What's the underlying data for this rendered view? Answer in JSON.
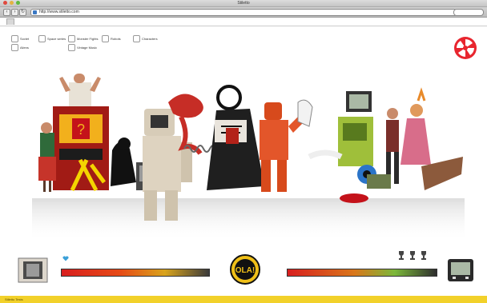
{
  "window": {
    "title": "Stiletto"
  },
  "browser": {
    "url": "http://www.stiletto.com",
    "back_icon": "arrow-left-icon",
    "forward_icon": "arrow-right-icon",
    "reload_icon": "reload-icon"
  },
  "filters": [
    {
      "label": "Soviet"
    },
    {
      "label": "Space series"
    },
    {
      "label": "Monster Fights"
    },
    {
      "label": "Robots"
    },
    {
      "label": "Characters"
    },
    {
      "label": "Aliens"
    },
    {
      "label": "Vintage Music"
    }
  ],
  "game": {
    "badge_text": "OLA!",
    "player_health_pct": 100,
    "opponent_health_pct": 100,
    "opponent_trophies": 3,
    "footer_text": "Stiletto Tests"
  },
  "colors": {
    "logo": "#e8262f",
    "badge_bg": "#f0c018",
    "footer": "#f2d12a"
  }
}
